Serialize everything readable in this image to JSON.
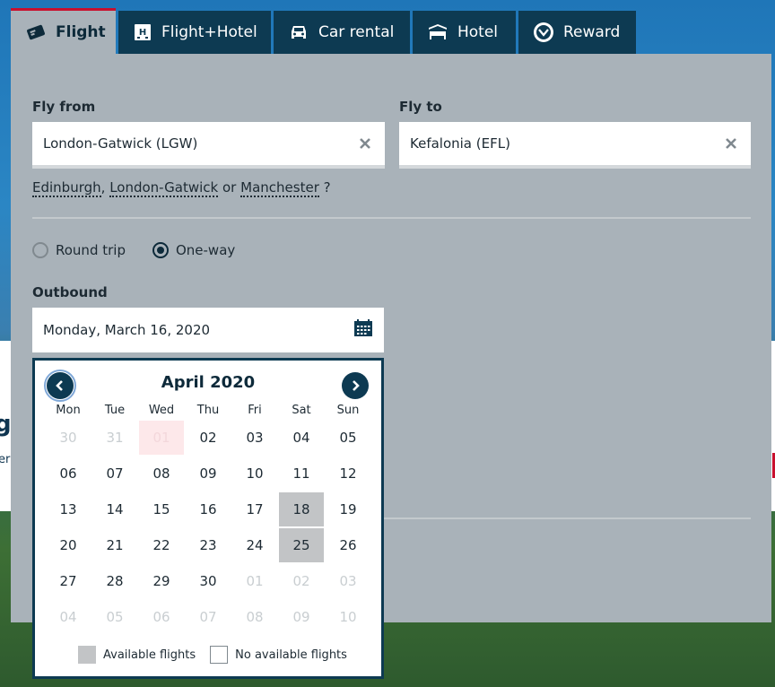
{
  "tabs": [
    {
      "label": "Flight",
      "icon": "ticket-icon",
      "active": true
    },
    {
      "label": "Flight+Hotel",
      "icon": "hotel-building-icon",
      "active": false
    },
    {
      "label": "Car rental",
      "icon": "car-icon",
      "active": false
    },
    {
      "label": "Hotel",
      "icon": "bed-icon",
      "active": false
    },
    {
      "label": "Reward",
      "icon": "reward-badge-icon",
      "active": false
    }
  ],
  "form": {
    "from_label": "Fly from",
    "from_value": "London-Gatwick (LGW)",
    "to_label": "Fly to",
    "to_value": "Kefalonia (EFL)",
    "suggestions": [
      "Edinburgh",
      "London-Gatwick",
      "Manchester"
    ],
    "suggest_sep1": ",",
    "suggest_or": "or",
    "suggest_end": "?",
    "trip_types": [
      {
        "label": "Round trip",
        "checked": false
      },
      {
        "label": "One-way",
        "checked": true
      }
    ],
    "outbound_label": "Outbound",
    "outbound_value": "Monday, March 16, 2020"
  },
  "calendar": {
    "month_label": "April 2020",
    "weekdays": [
      "Mon",
      "Tue",
      "Wed",
      "Thu",
      "Fri",
      "Sat",
      "Sun"
    ],
    "weeks": [
      [
        {
          "d": "30",
          "s": "other"
        },
        {
          "d": "31",
          "s": "other"
        },
        {
          "d": "01",
          "s": "today"
        },
        {
          "d": "02",
          "s": ""
        },
        {
          "d": "03",
          "s": ""
        },
        {
          "d": "04",
          "s": ""
        },
        {
          "d": "05",
          "s": ""
        }
      ],
      [
        {
          "d": "06",
          "s": ""
        },
        {
          "d": "07",
          "s": ""
        },
        {
          "d": "08",
          "s": ""
        },
        {
          "d": "09",
          "s": ""
        },
        {
          "d": "10",
          "s": ""
        },
        {
          "d": "11",
          "s": ""
        },
        {
          "d": "12",
          "s": ""
        }
      ],
      [
        {
          "d": "13",
          "s": ""
        },
        {
          "d": "14",
          "s": ""
        },
        {
          "d": "15",
          "s": ""
        },
        {
          "d": "16",
          "s": ""
        },
        {
          "d": "17",
          "s": ""
        },
        {
          "d": "18",
          "s": "available"
        },
        {
          "d": "19",
          "s": ""
        }
      ],
      [
        {
          "d": "20",
          "s": ""
        },
        {
          "d": "21",
          "s": ""
        },
        {
          "d": "22",
          "s": ""
        },
        {
          "d": "23",
          "s": ""
        },
        {
          "d": "24",
          "s": ""
        },
        {
          "d": "25",
          "s": "available"
        },
        {
          "d": "26",
          "s": ""
        }
      ],
      [
        {
          "d": "27",
          "s": ""
        },
        {
          "d": "28",
          "s": ""
        },
        {
          "d": "29",
          "s": ""
        },
        {
          "d": "30",
          "s": ""
        },
        {
          "d": "01",
          "s": "other"
        },
        {
          "d": "02",
          "s": "other"
        },
        {
          "d": "03",
          "s": "other"
        }
      ],
      [
        {
          "d": "04",
          "s": "other"
        },
        {
          "d": "05",
          "s": "other"
        },
        {
          "d": "06",
          "s": "other"
        },
        {
          "d": "07",
          "s": "other"
        },
        {
          "d": "08",
          "s": "other"
        },
        {
          "d": "09",
          "s": "other"
        },
        {
          "d": "10",
          "s": "other"
        }
      ]
    ],
    "legend_available": "Available flights",
    "legend_none": "No available flights"
  },
  "background": {
    "peek_text": "g",
    "peek_text2": "er"
  },
  "colors": {
    "navy": "#0d3a52",
    "panel": "#a9b2b9",
    "accent_red": "#c8102e",
    "available": "#c2c4c6"
  }
}
